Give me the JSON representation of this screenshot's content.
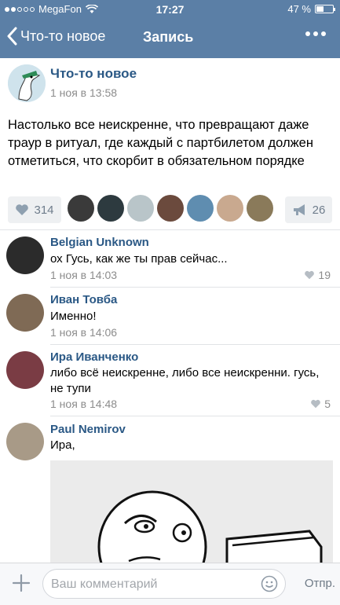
{
  "status_bar": {
    "carrier": "MegaFon",
    "time": "17:27",
    "battery": "47 %",
    "battery_level": 0.47
  },
  "header": {
    "back_label": "Что-то новое",
    "title": "Запись",
    "more_icon": "more-dots-icon"
  },
  "post": {
    "author": "Что-то новое",
    "date": "1 ноя в 13:58",
    "text": "Настолько все неискренне, что превращают даже траур в ритуал, где каждый с партбилетом должен отметиться, что скорбит в обязательном порядке",
    "likes": "314",
    "shares": "26",
    "liker_avatar_colors": [
      "#3a3a3a",
      "#2d3a3f",
      "#b9c5c9",
      "#6b4a3d",
      "#5f8db0",
      "#c9a98f",
      "#8a7a5a"
    ]
  },
  "comments": [
    {
      "name": "Belgian Unknown",
      "text": "ох Гусь, как же ты прав сейчас...",
      "date": "1 ноя в 14:03",
      "likes": "19"
    },
    {
      "name": "Иван Товба",
      "text": "Именно!",
      "date": "1 ноя в 14:06",
      "likes": ""
    },
    {
      "name": "Ира Иванченко",
      "text": "либо всё неискренне, либо все неискренни. гусь, не тупи",
      "date": "1 ноя в 14:48",
      "likes": "5"
    },
    {
      "name": "Paul Nemirov",
      "text": "Ира,",
      "date": "",
      "likes": ""
    }
  ],
  "composer": {
    "placeholder": "Ваш комментарий",
    "send_label": "Отпр."
  },
  "colors": {
    "header_bg": "#5b7fa6",
    "link": "#2a5885",
    "meta": "#8c8c8c"
  }
}
